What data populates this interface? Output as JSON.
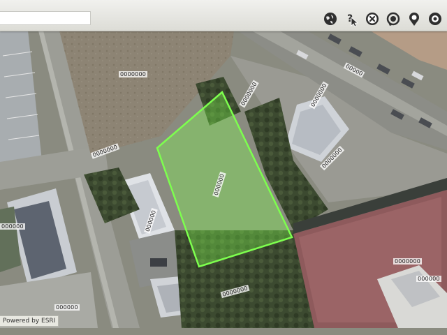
{
  "search": {
    "value": "",
    "placeholder": ""
  },
  "toolbar": {
    "tools": [
      {
        "name": "globe-icon"
      },
      {
        "name": "identify-icon"
      },
      {
        "name": "clear-icon"
      },
      {
        "name": "measure-icon"
      },
      {
        "name": "locate-icon"
      },
      {
        "name": "settings-icon"
      }
    ]
  },
  "map": {
    "selected_parcel_color": "#7dff4e",
    "parcel_labels": [
      "0000000",
      "0000000",
      "0000000",
      "00000",
      "0000000",
      "000000",
      "000000",
      "000000",
      "0000000",
      "0000000",
      "000000",
      "000000",
      "0000000"
    ]
  },
  "attribution": {
    "text": "Powered by ESRI"
  }
}
